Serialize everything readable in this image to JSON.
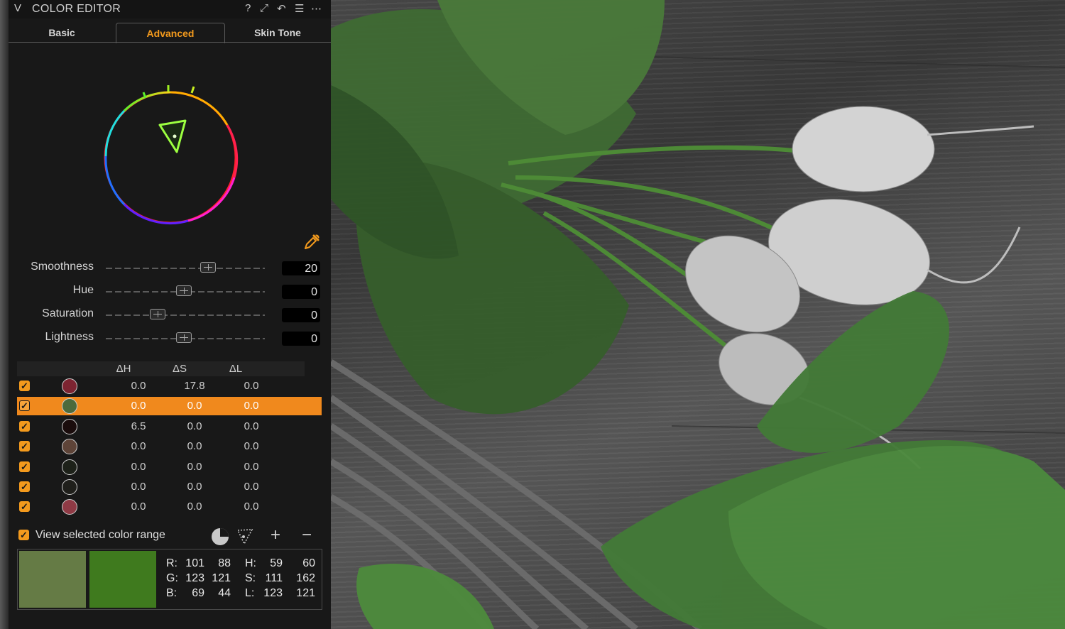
{
  "panel": {
    "title": "COLOR EDITOR",
    "header_icons": [
      "help-icon",
      "expand-icon",
      "undo-icon",
      "menu-icon",
      "more-icon"
    ],
    "header_glyphs": {
      "help": "?",
      "expand": "⤢",
      "undo": "↶",
      "menu": "☰",
      "more": "⋯",
      "collapse": "V"
    }
  },
  "tabs": [
    {
      "label": "Basic",
      "active": false
    },
    {
      "label": "Advanced",
      "active": true
    },
    {
      "label": "Skin Tone",
      "active": false
    }
  ],
  "sliders": [
    {
      "label": "Smoothness",
      "value": "20",
      "position": 0.65
    },
    {
      "label": "Hue",
      "value": "0",
      "position": 0.49
    },
    {
      "label": "Saturation",
      "value": "0",
      "position": 0.32
    },
    {
      "label": "Lightness",
      "value": "0",
      "position": 0.49
    }
  ],
  "table": {
    "headers": [
      "ΔH",
      "ΔS",
      "ΔL"
    ],
    "rows": [
      {
        "checked": true,
        "color": "#7d2431",
        "dh": "0.0",
        "ds": "17.8",
        "dl": "0.0",
        "selected": false
      },
      {
        "checked": true,
        "color": "#4d6a3c",
        "dh": "0.0",
        "ds": "0.0",
        "dl": "0.0",
        "selected": true
      },
      {
        "checked": true,
        "color": "#1a0c0c",
        "dh": "6.5",
        "ds": "0.0",
        "dl": "0.0",
        "selected": false
      },
      {
        "checked": true,
        "color": "#5e4438",
        "dh": "0.0",
        "ds": "0.0",
        "dl": "0.0",
        "selected": false
      },
      {
        "checked": true,
        "color": "#1d2119",
        "dh": "0.0",
        "ds": "0.0",
        "dl": "0.0",
        "selected": false
      },
      {
        "checked": true,
        "color": "#1f1f1b",
        "dh": "0.0",
        "ds": "0.0",
        "dl": "0.0",
        "selected": false
      },
      {
        "checked": true,
        "color": "#8f3a45",
        "dh": "0.0",
        "ds": "0.0",
        "dl": "0.0",
        "selected": false
      }
    ]
  },
  "view_range": {
    "label": "View selected color range",
    "checked": true
  },
  "range_buttons": {
    "add": "+",
    "remove": "−"
  },
  "readout": {
    "swatch_left": "#657b45",
    "swatch_right": "#3f7a1e",
    "r": "R:",
    "g": "G:",
    "b": "B:",
    "h": "H:",
    "s": "S:",
    "l": "L:",
    "r1": "101",
    "r2": "88",
    "g1": "123",
    "g2": "121",
    "b1": "69",
    "b2": "44",
    "h1": "59",
    "h2": "60",
    "s1": "111",
    "s2": "162",
    "l1": "123",
    "l2": "121"
  },
  "colors": {
    "accent": "#f39a1d",
    "selected_row": "#f0891d",
    "panel_bg": "#181818"
  }
}
